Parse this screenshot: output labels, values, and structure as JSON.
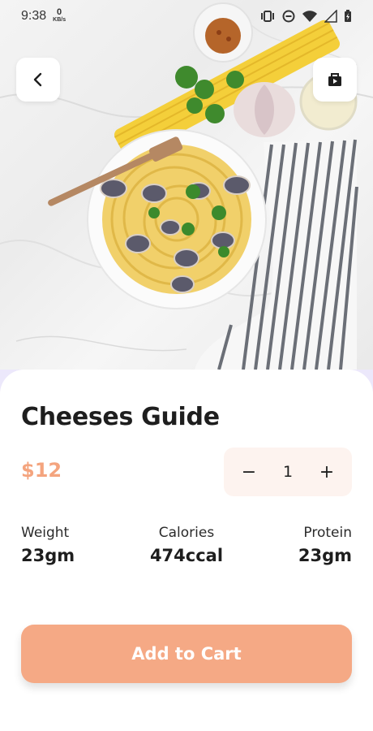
{
  "status_bar": {
    "time": "9:38",
    "speed_value": "0",
    "speed_unit": "KB/s",
    "icons": [
      "vibrate-icon",
      "do-not-disturb-icon",
      "wifi-icon",
      "signal-icon",
      "battery-icon"
    ]
  },
  "hero": {
    "image": "food-photo-spaghetti-with-clams",
    "back_icon": "chevron-left-icon",
    "bag_icon": "shopping-bag-icon"
  },
  "product": {
    "title": "Cheeses Guide",
    "price": "$12",
    "quantity": "1",
    "decrement_label": "−",
    "increment_label": "+"
  },
  "stats": [
    {
      "label": "Weight",
      "value": "23gm"
    },
    {
      "label": "Calories",
      "value": "474ccal"
    },
    {
      "label": "Protein",
      "value": "23gm"
    }
  ],
  "cart": {
    "label": "Add to Cart"
  },
  "colors": {
    "accent": "#f5a985",
    "price": "#f4a47e",
    "stepper_bg": "#fdf3ef",
    "sheet_tint": "#ece8fb"
  }
}
